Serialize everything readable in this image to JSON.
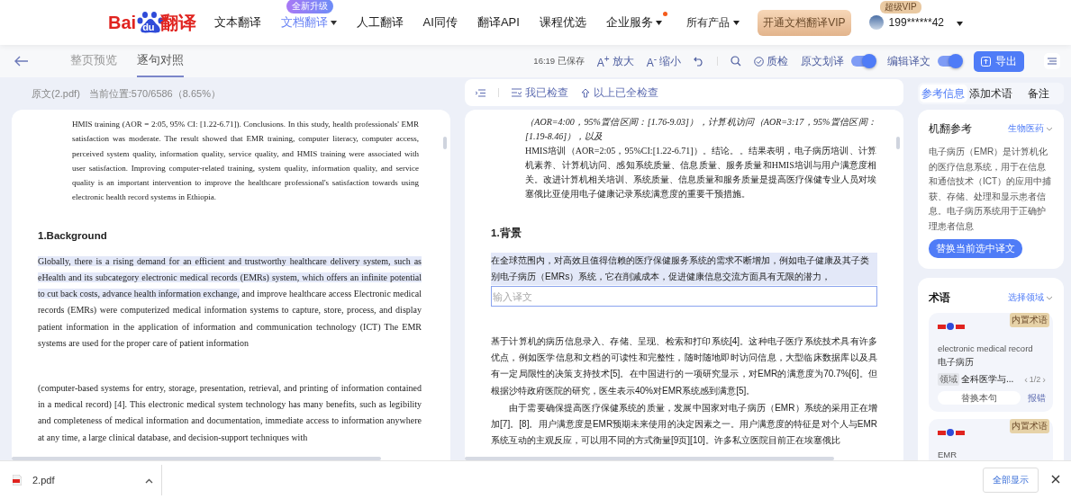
{
  "logo": {
    "left": "Bai",
    "paw": "du",
    "right": "翻译"
  },
  "nav": [
    {
      "label": "文本翻译",
      "selected": false
    },
    {
      "label": "文档翻译",
      "selected": true,
      "dropdown": true,
      "badge": "全新升级"
    },
    {
      "label": "人工翻译",
      "selected": false
    },
    {
      "label": "AI同传",
      "selected": false
    },
    {
      "label": "翻译API",
      "selected": false
    },
    {
      "label": "课程优选",
      "selected": false
    },
    {
      "label": "企业服务",
      "selected": false,
      "dropdown": true,
      "dot": true
    }
  ],
  "products": "所有产品",
  "vip_button": "开通文档翻译VIP",
  "user": {
    "badge": "超级VIP",
    "name": "199******42"
  },
  "view_tabs": [
    {
      "label": "整页预览",
      "selected": false
    },
    {
      "label": "逐句对照",
      "selected": true
    }
  ],
  "saved": "16:19 已保存",
  "zoom": [
    {
      "icon": "A$^{+}$",
      "label": "放大"
    },
    {
      "icon": "A$^{-}$",
      "label": "缩小"
    }
  ],
  "quality": "质检",
  "toggles": [
    {
      "label": "原文划译",
      "on": true
    },
    {
      "label": "编辑译文",
      "on": true
    }
  ],
  "export": "导出",
  "source_info": {
    "file": "原文(2.pdf)",
    "position": "当前位置:570/6586（8.65%）"
  },
  "check_bar": {
    "checked": "我已检查",
    "all_checked": "以上已全检查"
  },
  "source": {
    "abstract": "HMIS training (AOR = 2:05, 95% CI: [1.22-6.71]). Conclusions. In this study, health professionals' EMR satisfaction was moderate. The result showed that EMR training, computer literacy, computer access, perceived system quality, information quality, service quality, and HMIS training were associated with user satisfaction. Improving computer-related training, system quality, information quality, and service quality is an important intervention to improve the healthcare professional's satisfaction towards using electronic health record systems in Ethiopia.",
    "heading": "1.Background",
    "paragraphs": [
      {
        "segments": [
          {
            "text": "Globally, there is a rising demand for an efficient and trustworthy healthcare delivery system, such as eHealth and its subcategory electronic medical records (EMRs) system, which offers an infinite potential to cut back costs, advance health information exchange,",
            "highlighted": true
          },
          {
            "text": " and improve healthcare access Electronic medical records (EMRs) were computerized medical information systems to capture, store, process, and display patient information in the application of information and communication technology (ICT) The EMR systems are used for the proper care of patient information",
            "highlighted": false
          }
        ]
      },
      {
        "segments": [
          {
            "text": "(computer-based systems for entry, storage, presentation, retrieval, and printing of information contained in a medical record) [4]. This electronic medical system technology has many benefits, such as legibility and completeness of medical information and documentation, immediate access to information anywhere at any time, a large clinical database, and decision-support techniques with",
            "highlighted": false
          }
        ]
      }
    ]
  },
  "target": {
    "abstract": [
      {
        "text": "（AOR=4:00，95%置信区间：[1.76-9.03]），计算机访问（AOR=3:17，95%置信区间：[1.19-8.46]），以及",
        "italic": true
      },
      {
        "text": "HMIS培训（AOR=2:05，95%CI:[1.22-6.71]）。结论。。结果表明，电子病历培训、计算机素养、计算机访问、感知系统质量、信息质量、服务质量和HMIS培训与用户满意度相关。改进计算机相关培训、系统质量、信息质量和服务质量是提高医疗保健专业人员对埃塞俄比亚使用电子健康记录系统满意度的重要干预措施。",
        "italic": false
      }
    ],
    "heading": "1.背景",
    "selected_sentence": "在全球范围内，对高效且值得信赖的医疗保健服务系统的需求不断增加，例如电子健康及其子类别电子病历（EMRs）系统，它在削减成本，促进健康信息交流方面具有无限的潜力，",
    "input_placeholder": "输入译文",
    "paragraphs": [
      {
        "text": "基于计算机的病历信息录入、存储、呈现、检索和打印系统[4]。这种电子医疗系统技术具有许多优点，例如医学信息和文档的可读性和完整性，随时随地即时访问信息，大型临床数据库以及具有一定局限性的决策支持技术[5]。在中国进行的一项研究显示，对EMR的满意度为70.7%[6]。但根据沙特政府医院的研究，医生表示40%对EMR系统感到满意[5]。",
        "indent": false
      },
      {
        "text": "由于需要确保提高医疗保健系统的质量，发展中国家对电子病历（EMR）系统的采用正在增加[7]。[8]。用户满意度是EMR预期未来使用的决定因素之一。用户满意度的特征是对个人与EMR系统互动的主观反应，可以用不同的方式衡量[9页][10]。许多私立医院目前正在埃塞俄比",
        "indent": true
      }
    ]
  },
  "side_tabs": [
    {
      "label": "参考信息",
      "selected": true
    },
    {
      "label": "添加术语",
      "selected": false
    },
    {
      "label": "备注",
      "selected": false
    }
  ],
  "mt_reference": {
    "title": "机翻参考",
    "domain": "生物医药",
    "text": "电子病历（EMR）是计算机化的医疗信息系统，用于在信息和通信技术（ICT）的应用中捕获、存储、处理和显示患者信息。电子病历系统用于正确护理患者信息",
    "button": "替换当前选中译文"
  },
  "terms": {
    "title": "术语",
    "domain": "选择领域",
    "items": [
      {
        "badge": "内置术语",
        "source": "electronic medical record",
        "target": "电子病历",
        "tag": "领域",
        "field": "全科医学与...",
        "prev": "‹",
        "page": "1/2",
        "next": "›",
        "replace": "替换本句",
        "report": "报错"
      },
      {
        "badge": "内置术语",
        "source": "EMR"
      }
    ]
  },
  "download": {
    "file": "2.pdf",
    "show_all": "全部显示"
  }
}
